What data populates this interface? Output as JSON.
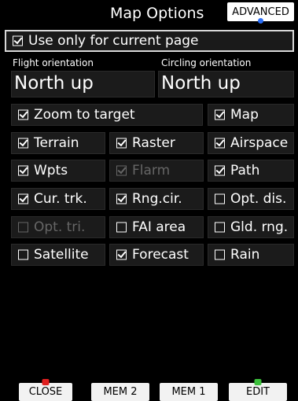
{
  "title": "Map Options",
  "advanced_label": "ADVANCED",
  "use_current_page": {
    "label": "Use only for current page",
    "checked": true
  },
  "flight_orientation": {
    "label": "Flight orientation",
    "value": "North up"
  },
  "circling_orientation": {
    "label": "Circling orientation",
    "value": "North up"
  },
  "options": {
    "zoom_to_target": {
      "label": "Zoom to target",
      "checked": true,
      "enabled": true
    },
    "map": {
      "label": "Map",
      "checked": true,
      "enabled": true
    },
    "terrain": {
      "label": "Terrain",
      "checked": true,
      "enabled": true
    },
    "raster": {
      "label": "Raster",
      "checked": true,
      "enabled": true
    },
    "airspace": {
      "label": "Airspace",
      "checked": true,
      "enabled": true
    },
    "wpts": {
      "label": "Wpts",
      "checked": true,
      "enabled": true
    },
    "flarm": {
      "label": "Flarm",
      "checked": true,
      "enabled": false
    },
    "path": {
      "label": "Path",
      "checked": true,
      "enabled": true
    },
    "cur_trk": {
      "label": "Cur. trk.",
      "checked": true,
      "enabled": true
    },
    "rng_cir": {
      "label": "Rng.cir.",
      "checked": true,
      "enabled": true
    },
    "opt_dis": {
      "label": "Opt. dis.",
      "checked": false,
      "enabled": true
    },
    "opt_tri": {
      "label": "Opt. tri.",
      "checked": false,
      "enabled": false
    },
    "fai_area": {
      "label": "FAI area",
      "checked": false,
      "enabled": true
    },
    "gld_rng": {
      "label": "Gld. rng.",
      "checked": false,
      "enabled": true
    },
    "satellite": {
      "label": "Satellite",
      "checked": false,
      "enabled": true
    },
    "forecast": {
      "label": "Forecast",
      "checked": true,
      "enabled": true
    },
    "rain": {
      "label": "Rain",
      "checked": false,
      "enabled": true
    }
  },
  "buttons": {
    "close": "CLOSE",
    "mem2": "MEM 2",
    "mem1": "MEM 1",
    "edit": "EDIT"
  },
  "colors": {
    "close_indicator": "#e02020",
    "edit_indicator": "#3cc03c",
    "advanced_indicator": "#2b6ef5"
  }
}
